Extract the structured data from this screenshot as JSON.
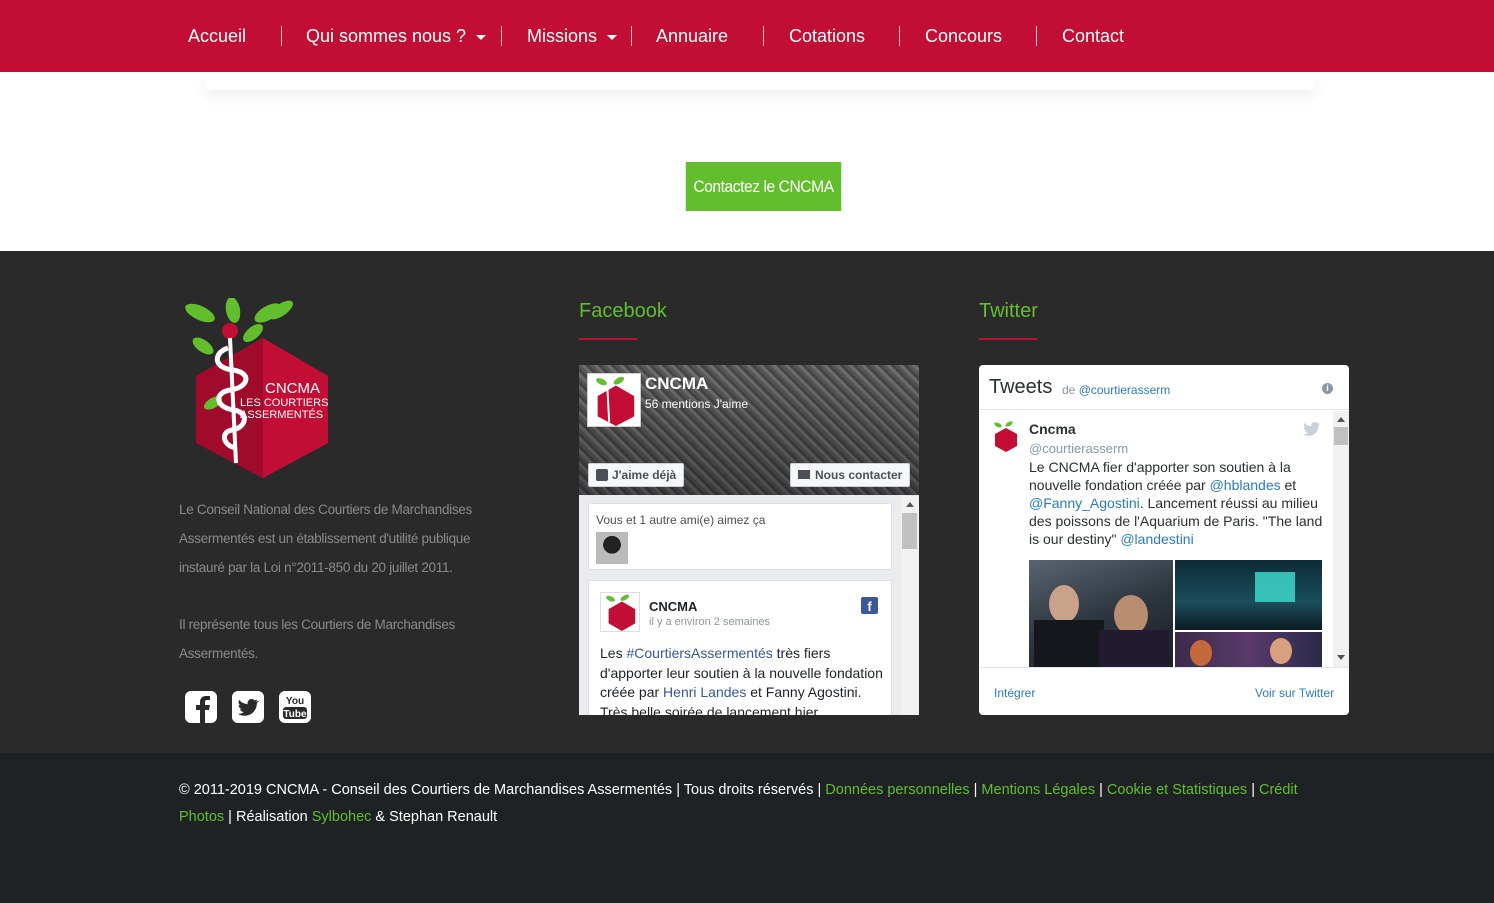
{
  "nav": {
    "items": [
      {
        "label": "Accueil"
      },
      {
        "label": "Qui sommes nous ?"
      },
      {
        "label": "Missions"
      },
      {
        "label": "Annuaire"
      },
      {
        "label": "Cotations"
      },
      {
        "label": "Concours"
      },
      {
        "label": "Contact"
      }
    ]
  },
  "cta": {
    "label": "Contactez le CNCMA"
  },
  "footer": {
    "logo": {
      "line1": "CNCMA",
      "line2": "LES COURTIERS",
      "line3": "ASSERMENTÉS"
    },
    "about": {
      "p1_prefix_c": "C",
      "p1": "Le Conseil National des Courtiers de Marchandises Assermentés est un établissement d'utilité publique instauré par la Loi n°2011-850 du 20 juillet 2011.",
      "p2": "Il représente tous les Courtiers de Marchandises Assermentés."
    },
    "social": [
      {
        "icon": "facebook-icon"
      },
      {
        "icon": "twitter-icon"
      },
      {
        "icon": "youtube-icon",
        "label_top": "You",
        "label_bottom": "Tube"
      }
    ],
    "facebook": {
      "title": "Facebook",
      "page_name": "CNCMA",
      "likes": "56 mentions J'aime",
      "like_button": "J'aime déjà",
      "contact_button": "Nous contacter",
      "friends_text": "Vous et 1 autre ami(e) aimez ça",
      "post": {
        "author": "CNCMA",
        "time": "il y a environ 2 semaines",
        "text_1": "Les ",
        "hashtag": "#CourtiersAssermentés",
        "text_2": " très fiers d'apporter leur soutien à la nouvelle fondation créée par ",
        "mention": "Henri Landes",
        "text_3": " et Fanny Agostini. Très belle soirée de lancement hier"
      }
    },
    "twitter": {
      "title": "Twitter",
      "widget_title": "Tweets",
      "by_prefix": "de",
      "by_handle": "@courtierasserm",
      "tweet": {
        "name": "Cncma",
        "handle": "@courtierasserm",
        "t1": "Le CNCMA fier d'apporter son soutien à la nouvelle fondation créée par ",
        "m1": "@hblandes",
        "t2": " et ",
        "m2": "@Fanny_Agostini",
        "t3": ". Lancement réussi au milieu des poissons de l'Aquarium de Paris. \"The land is our destiny\" ",
        "m3": "@landestini"
      },
      "embed_label": "Intégrer",
      "view_label": "Voir sur Twitter"
    }
  },
  "bottom": {
    "copyright": "© 2011-2019 CNCMA - Conseil des Courtiers de Marchandises Assermentés | Tous droits réservés | ",
    "link_privacy": "Données personnelles",
    "sep": " | ",
    "link_legal": "Mentions Légales",
    "link_cookies": "Cookie et Statistiques",
    "link_credits": "Crédit Photos",
    "realisation": " | Réalisation ",
    "link_sylbohec": "Sylbohec",
    "and_name": " & Stephan Renault"
  },
  "colors": {
    "brand_red": "#c20e35",
    "accent_green": "#62be2c",
    "footer_dark": "#2a2a2a",
    "bottom_dark": "#1f2224"
  }
}
